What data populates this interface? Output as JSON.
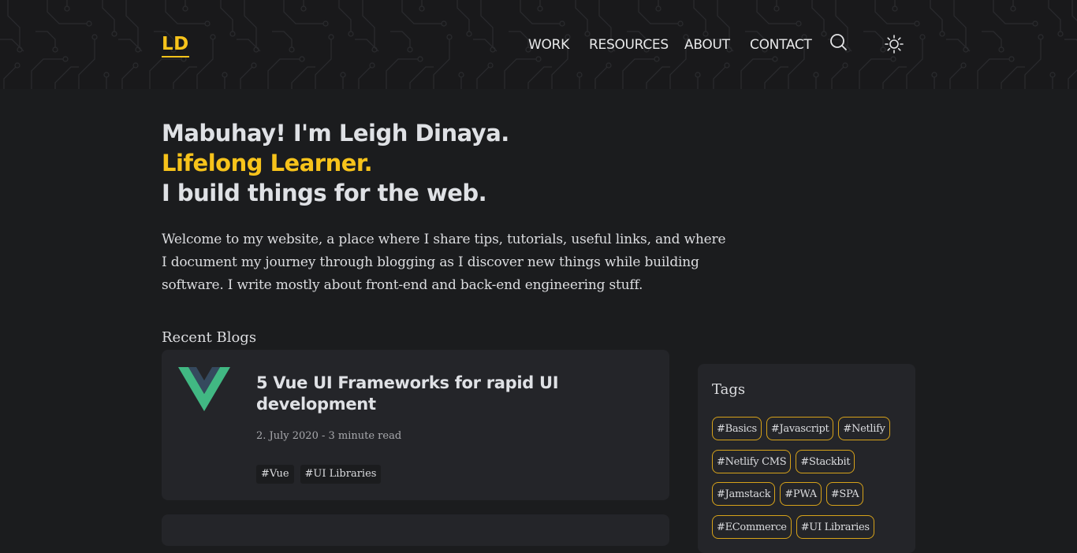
{
  "colors": {
    "accent": "#f7c31b",
    "background": "#1b1c1e",
    "card": "#242529",
    "vue_green": "#41b883",
    "vue_dark": "#35495e"
  },
  "header": {
    "logo": "LD",
    "nav": [
      {
        "label": "WORK"
      },
      {
        "label": "RESOURCES"
      },
      {
        "label": "ABOUT"
      },
      {
        "label": "CONTACT"
      }
    ],
    "search_icon": "search-icon",
    "theme_icon": "sun-icon"
  },
  "hero": {
    "line1": "Mabuhay! I'm Leigh Dinaya.",
    "line2": "Lifelong Learner.",
    "line3": "I build things for the web."
  },
  "intro": {
    "lines": [
      "Welcome to my website, a place where I share tips, tutorials, useful links, and where",
      "I document my journey through blogging as I discover new things while building",
      "software. I write mostly about front-end and back-end engineering stuff."
    ]
  },
  "recent_blogs": {
    "title": "Recent Blogs",
    "posts": [
      {
        "title": "5 Vue UI Frameworks for rapid UI development",
        "meta": "2. July 2020 - 3 minute read",
        "tags": [
          "#Vue",
          "#UI Libraries"
        ],
        "icon": "vue-logo-icon"
      }
    ]
  },
  "tags": {
    "title": "Tags",
    "rows": [
      [
        "#Basics",
        "#Javascript",
        "#Netlify"
      ],
      [
        "#Netlify CMS",
        "#Stackbit"
      ],
      [
        "#Jamstack",
        "#PWA",
        "#SPA"
      ],
      [
        "#ECommerce",
        "#UI Libraries"
      ]
    ]
  }
}
